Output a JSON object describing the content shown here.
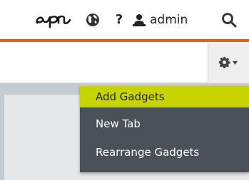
{
  "header": {
    "logo_icon": "episerver-logo-icon",
    "globe_icon": "globe-icon",
    "help_label": "?",
    "user": {
      "icon": "user-icon",
      "name": "admin"
    },
    "search_icon": "search-icon",
    "accent_color": "#ee5a1d"
  },
  "toolbar": {
    "settings_icon": "gear-icon",
    "dropdown_icon": "caret-down-icon"
  },
  "menu": {
    "highlight_color": "#c8d400",
    "background_color": "#4a5158",
    "items": [
      {
        "label": "Add Gadgets",
        "active": true
      },
      {
        "label": "New Tab",
        "active": false
      },
      {
        "label": "Rearrange Gadgets",
        "active": false
      }
    ]
  }
}
